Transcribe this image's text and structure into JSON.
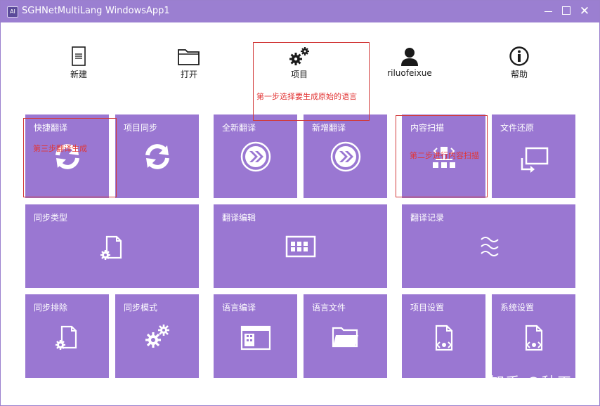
{
  "window": {
    "app_name": "SGHNetMultiLang",
    "window_name": "WindowsApp1",
    "icon_text": "AΙ",
    "close_glyph": "✕"
  },
  "toolbar": {
    "new": "新建",
    "open": "打开",
    "project": "项目",
    "user": "riluofeixue",
    "help": "帮助"
  },
  "tiles": {
    "quick_translate": "快捷翻译",
    "project_sync": "项目同步",
    "full_translate": "全新翻译",
    "incremental_translate": "新增翻译",
    "content_scan": "内容扫描",
    "file_restore": "文件还原",
    "sync_type": "同步类型",
    "translation_edit": "翻译编辑",
    "translation_log": "翻译记录",
    "sync_exclude": "同步排除",
    "sync_mode": "同步模式",
    "language_compile": "语言编译",
    "language_file": "语言文件",
    "project_settings": "项目设置",
    "system_settings": "系统设置"
  },
  "annotations": {
    "step1": "第一步选择要生成原始的语言",
    "step2": "第二步进行内容扫描",
    "step3": "第三步翻译生成"
  },
  "watermark": "知乎 @秋天",
  "colors": {
    "titlebar": "#9b7fd1",
    "tile": "#9a77d2",
    "annotation": "#d23a3a"
  }
}
